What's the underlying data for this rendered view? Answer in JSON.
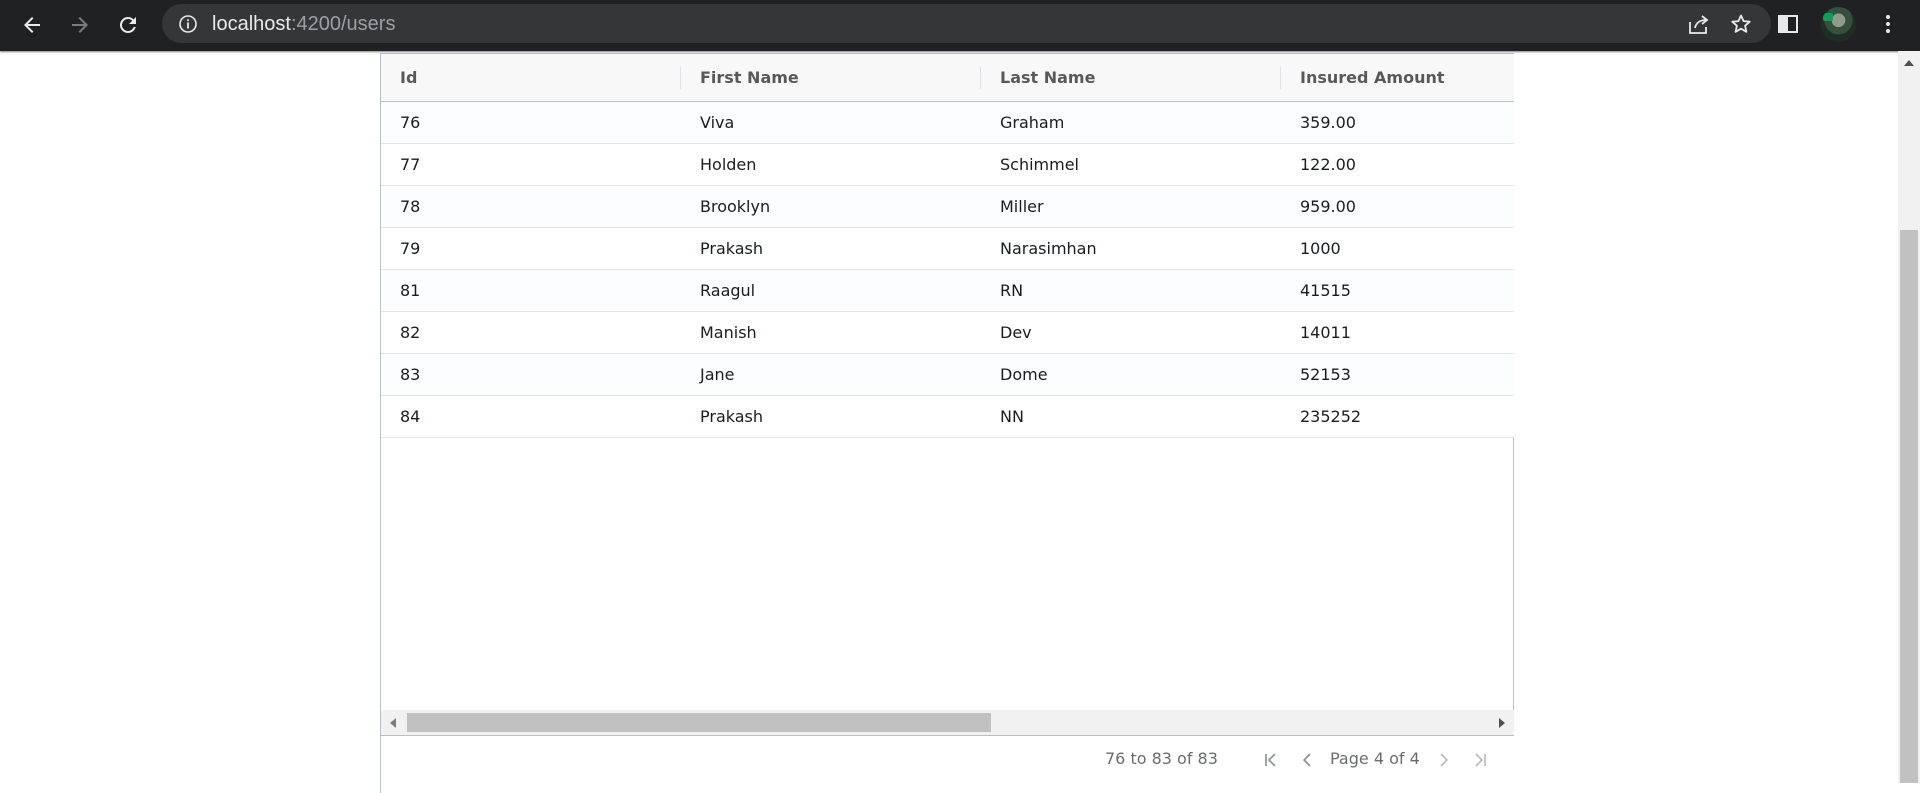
{
  "browser": {
    "url_host": "localhost",
    "url_path": ":4200/users"
  },
  "grid": {
    "columns": [
      "Id",
      "First Name",
      "Last Name",
      "Insured Amount"
    ],
    "rows": [
      [
        "76",
        "Viva",
        "Graham",
        "359.00"
      ],
      [
        "77",
        "Holden",
        "Schimmel",
        "122.00"
      ],
      [
        "78",
        "Brooklyn",
        "Miller",
        "959.00"
      ],
      [
        "79",
        "Prakash",
        "Narasimhan",
        "1000"
      ],
      [
        "81",
        "Raagul",
        "RN",
        "41515"
      ],
      [
        "82",
        "Manish",
        "Dev",
        "14011"
      ],
      [
        "83",
        "Jane",
        "Dome",
        "52153"
      ],
      [
        "84",
        "Prakash",
        "NN",
        "235252"
      ]
    ]
  },
  "paging": {
    "summary": "76 to 83 of 83",
    "page_text": "Page 4 of 4"
  },
  "icons": {
    "back": "back-arrow-icon",
    "forward": "forward-arrow-icon",
    "reload": "reload-icon",
    "info": "info-icon",
    "share": "share-icon",
    "bookmark": "star-icon",
    "side_panel": "side-panel-icon",
    "menu": "kebab-menu-icon",
    "first_page": "first-page-icon",
    "prev_page": "previous-page-icon",
    "next_page": "next-page-icon",
    "last_page": "last-page-icon"
  },
  "colors": {
    "chrome_bg": "#202124",
    "omnibox_bg": "#35363a",
    "grid_border": "#babfc7",
    "row_border": "#dde2eb"
  }
}
